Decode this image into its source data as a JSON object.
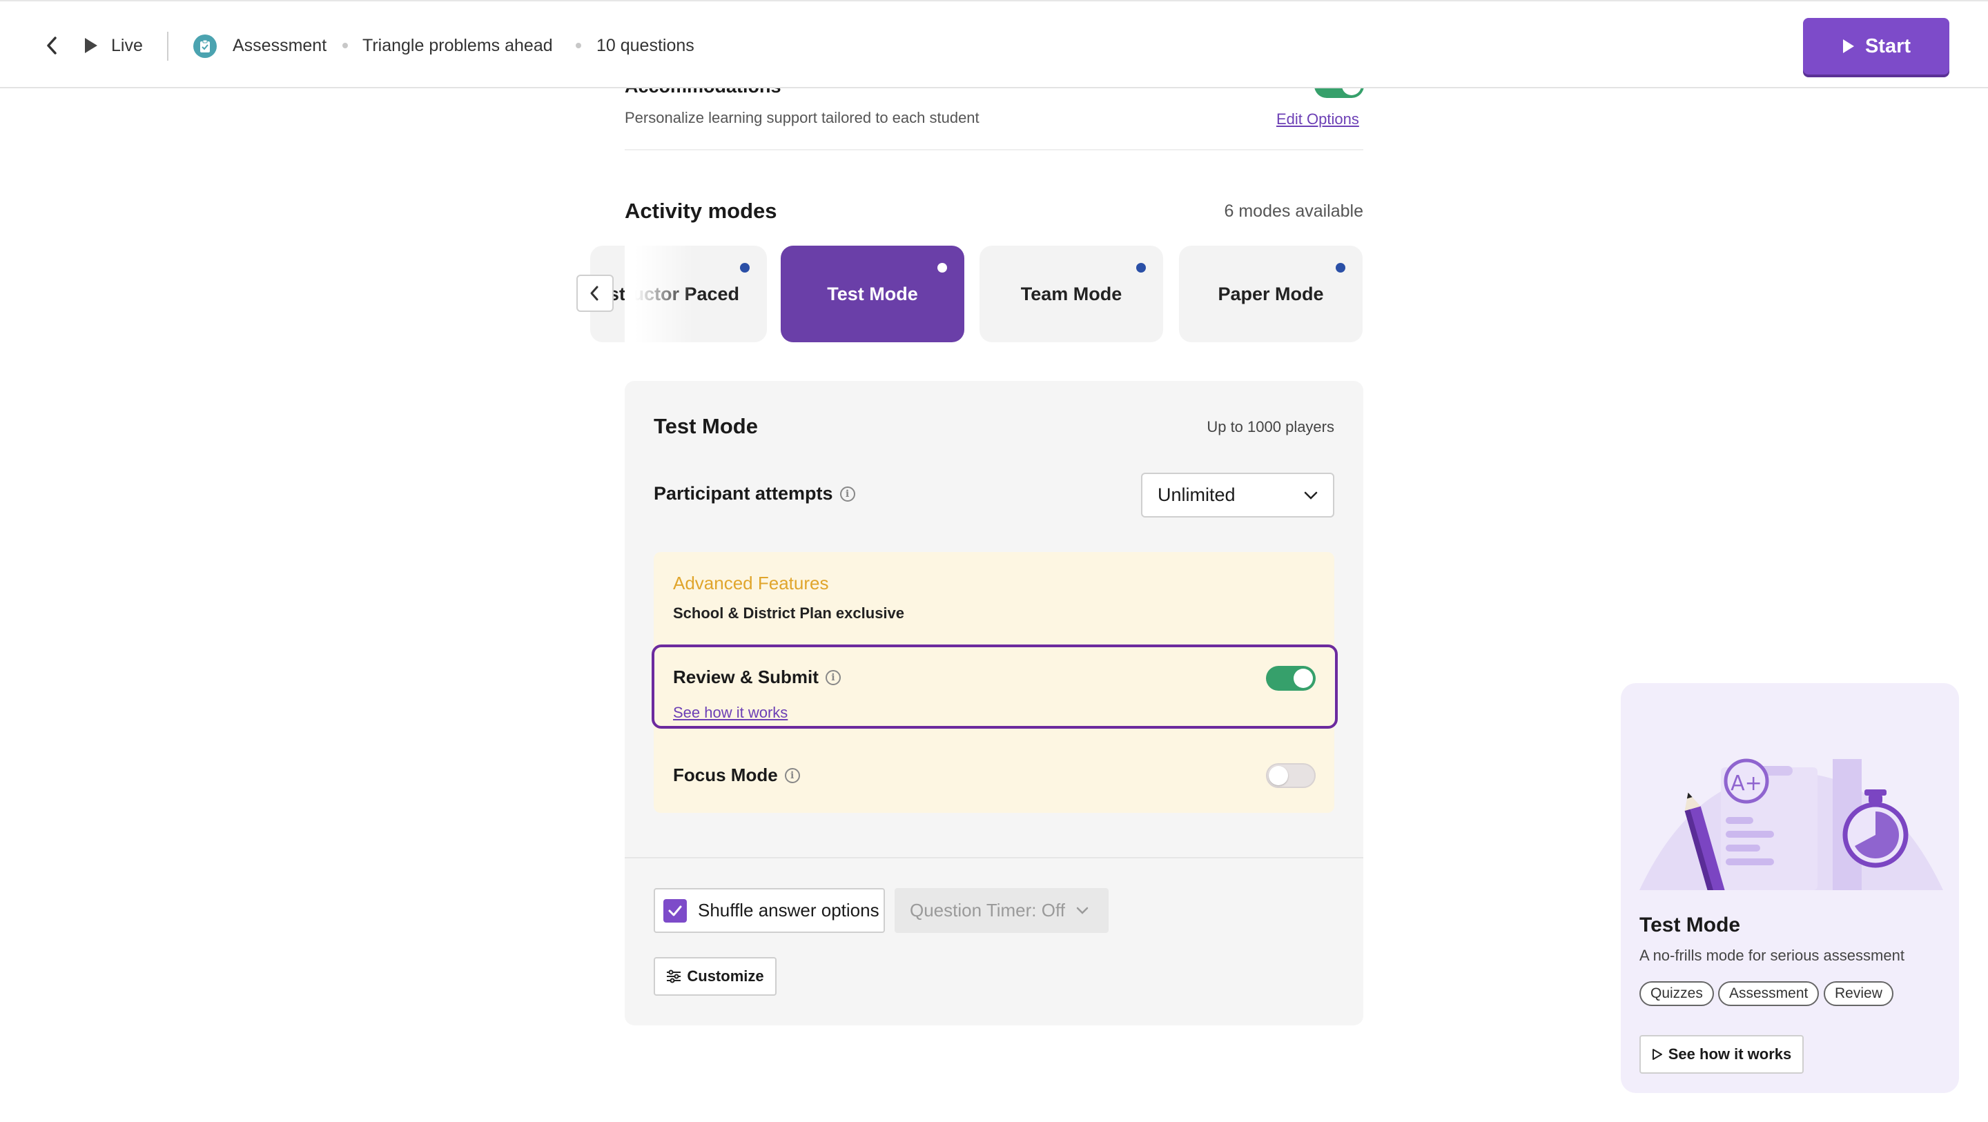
{
  "header": {
    "live_label": "Live",
    "type_label": "Assessment",
    "quiz_title": "Triangle problems ahead",
    "question_count": "10 questions",
    "start_label": "Start"
  },
  "accommodations": {
    "title": "Accommodations",
    "description": "Personalize learning support tailored to each student",
    "edit_link": "Edit Options",
    "enabled": true
  },
  "activity_modes": {
    "title": "Activity modes",
    "count_label": "6 modes available",
    "modes": [
      {
        "label": "Instructor Paced",
        "active": false
      },
      {
        "label": "Test Mode",
        "active": true
      },
      {
        "label": "Team Mode",
        "active": false
      },
      {
        "label": "Paper Mode",
        "active": false
      }
    ]
  },
  "panel": {
    "title": "Test Mode",
    "players": "Up to 1000 players",
    "attempts_label": "Participant attempts",
    "attempts_value": "Unlimited",
    "advanced": {
      "title": "Advanced Features",
      "subtitle": "School & District Plan exclusive",
      "review_submit": {
        "label": "Review & Submit",
        "link": "See how it works",
        "enabled": true
      },
      "focus_mode": {
        "label": "Focus Mode",
        "enabled": false
      }
    },
    "shuffle_label": "Shuffle answer options",
    "shuffle_checked": true,
    "timer_label": "Question Timer: Off",
    "customize_label": "Customize"
  },
  "info_card": {
    "title": "Test Mode",
    "description": "A no-frills mode for serious assessment",
    "tags": [
      "Quizzes",
      "Assessment",
      "Review"
    ],
    "button_label": "See how it works",
    "grade_text": "A+"
  },
  "colors": {
    "brand_purple": "#7d4bc9",
    "active_mode": "#6a3fa8",
    "toggle_on": "#36a06b",
    "advanced_title": "#e0a52c",
    "highlight_border": "#6c2b9e",
    "mode_dot": "#2a4fa6"
  }
}
